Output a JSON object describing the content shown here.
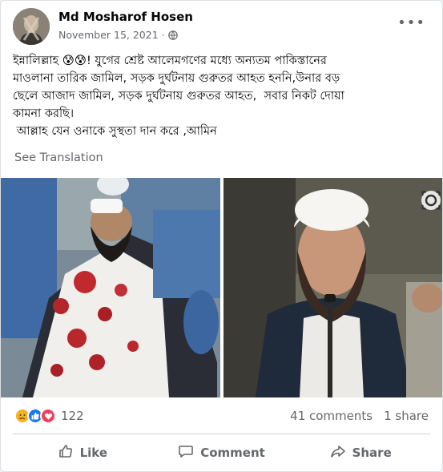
{
  "post": {
    "author": "Md Mosharof Hosen",
    "date": "November 15, 2021",
    "date_separator": "·",
    "privacy_icon": "globe-icon",
    "more_icon": "more-options-icon",
    "text_lines": [
      "ইন্নালিল্লাহ 😰😰! যুগের শ্রেষ্ট আলেমগণের মধ্যে অন্যতম পাকিস্তানের",
      "মাওলানা তারিক জামিল, সড়ক দুর্ঘটনায় গুরুতর আহত হননি,উনার বড়",
      "ছেলে আজাদ জামিল, সড়ক দুর্ঘটনায় গুরুতর আহত,  সবার নিকট দোয়া",
      "কামনা করছি।",
      " আল্লাহ যেন ওনাকে সুস্থতা দান করে ,আমিন"
    ],
    "see_translation": "See Translation"
  },
  "photos": [
    {
      "name": "injured-man-photo"
    },
    {
      "name": "cleric-press-photo"
    }
  ],
  "reactions": {
    "icons": [
      "sad-reaction-icon",
      "like-reaction-icon",
      "love-reaction-icon"
    ],
    "count": "122",
    "comments": "41 comments",
    "shares": "1 share"
  },
  "actions": {
    "like": "Like",
    "comment": "Comment",
    "share": "Share"
  },
  "colors": {
    "accent": "#1877f2",
    "secondary_text": "#65676b",
    "love": "#f33e58",
    "sad": "#f7b125"
  }
}
